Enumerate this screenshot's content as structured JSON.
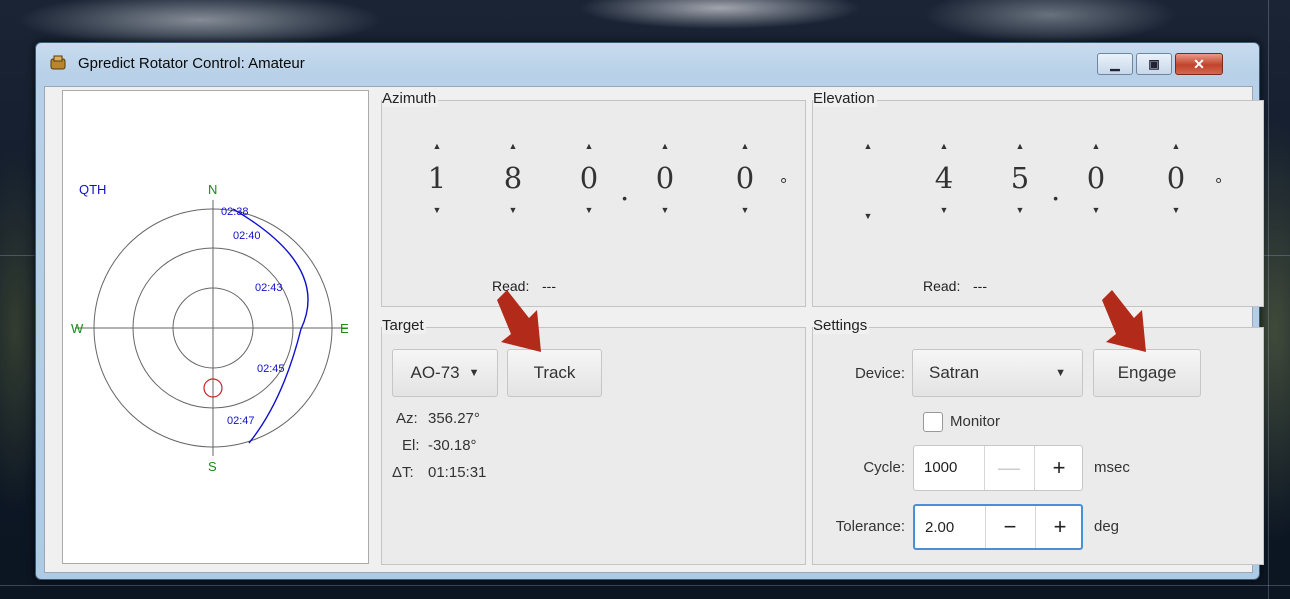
{
  "window": {
    "title": "Gpredict Rotator Control: Amateur"
  },
  "polar": {
    "qth": "QTH",
    "north": "N",
    "south": "S",
    "east": "E",
    "west": "W",
    "times": [
      "02:38",
      "02:40",
      "02:43",
      "02:45",
      "02:47"
    ]
  },
  "azimuth": {
    "legend": "Azimuth",
    "digits": [
      "1",
      "8",
      "0",
      "0",
      "0"
    ],
    "dot": ".",
    "degree": "°",
    "read_label": "Read:",
    "read_value": "---"
  },
  "elevation": {
    "legend": "Elevation",
    "digits": [
      "",
      "4",
      "5",
      "0",
      "0"
    ],
    "dot": ".",
    "degree": "°",
    "read_label": "Read:",
    "read_value": "---"
  },
  "target": {
    "legend": "Target",
    "satellite": "AO-73",
    "track_label": "Track",
    "az_label": "Az:",
    "az_value": "356.27°",
    "el_label": "El:",
    "el_value": "-30.18°",
    "dt_label": "ΔT:",
    "dt_value": "01:15:31"
  },
  "settings": {
    "legend": "Settings",
    "device_label": "Device:",
    "device_value": "Satran",
    "engage_label": "Engage",
    "monitor_label": "Monitor",
    "cycle_label": "Cycle:",
    "cycle_value": "1000",
    "cycle_unit": "msec",
    "tolerance_label": "Tolerance:",
    "tolerance_value": "2.00",
    "tolerance_unit": "deg"
  },
  "icons": {
    "up": "▲",
    "down": "▼",
    "combo": "▼",
    "minus": "—",
    "minus2": "−",
    "plus": "+",
    "min": "▁",
    "max": "▣",
    "close": "✕"
  },
  "colors": {
    "track_blue": "#1010cc",
    "compass_green": "#1a8a1a",
    "target_red": "#cc2222",
    "arrow_red": "#b22a1a"
  }
}
